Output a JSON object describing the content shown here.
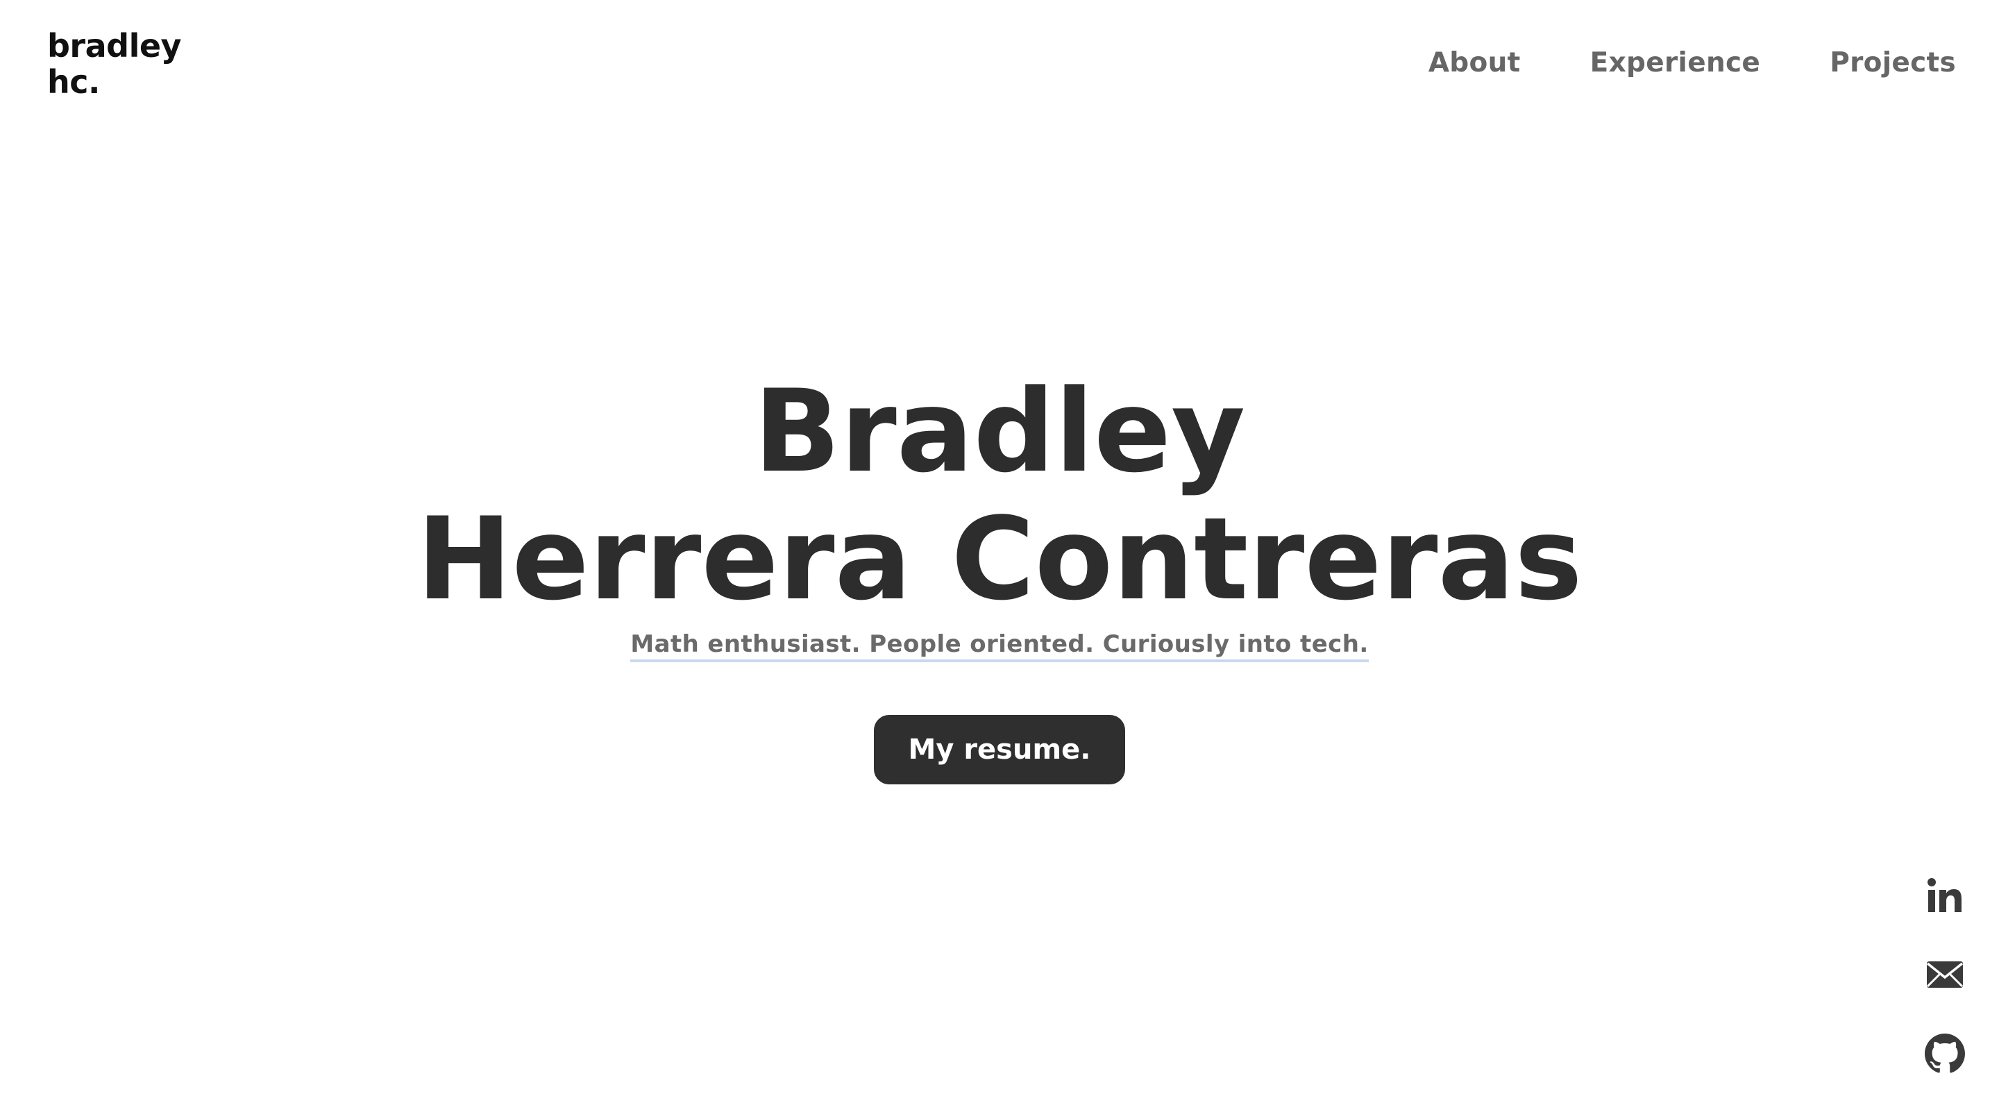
{
  "header": {
    "logo_line1": "bradley",
    "logo_line2": "hc.",
    "nav": [
      {
        "label": "About"
      },
      {
        "label": "Experience"
      },
      {
        "label": "Projects"
      }
    ]
  },
  "hero": {
    "name_line1": "Bradley",
    "name_line2": "Herrera Contreras",
    "tagline": "Math enthusiast. People oriented. Curiously into tech.",
    "resume_label": "My resume."
  },
  "social": {
    "icons": [
      "linkedin-icon",
      "mail-icon",
      "github-icon"
    ]
  },
  "colors": {
    "text_dark": "#2d2d2d",
    "nav_gray": "#666666",
    "button_bg": "#2f2f2f",
    "underline_blue": "#c9d8f2"
  }
}
